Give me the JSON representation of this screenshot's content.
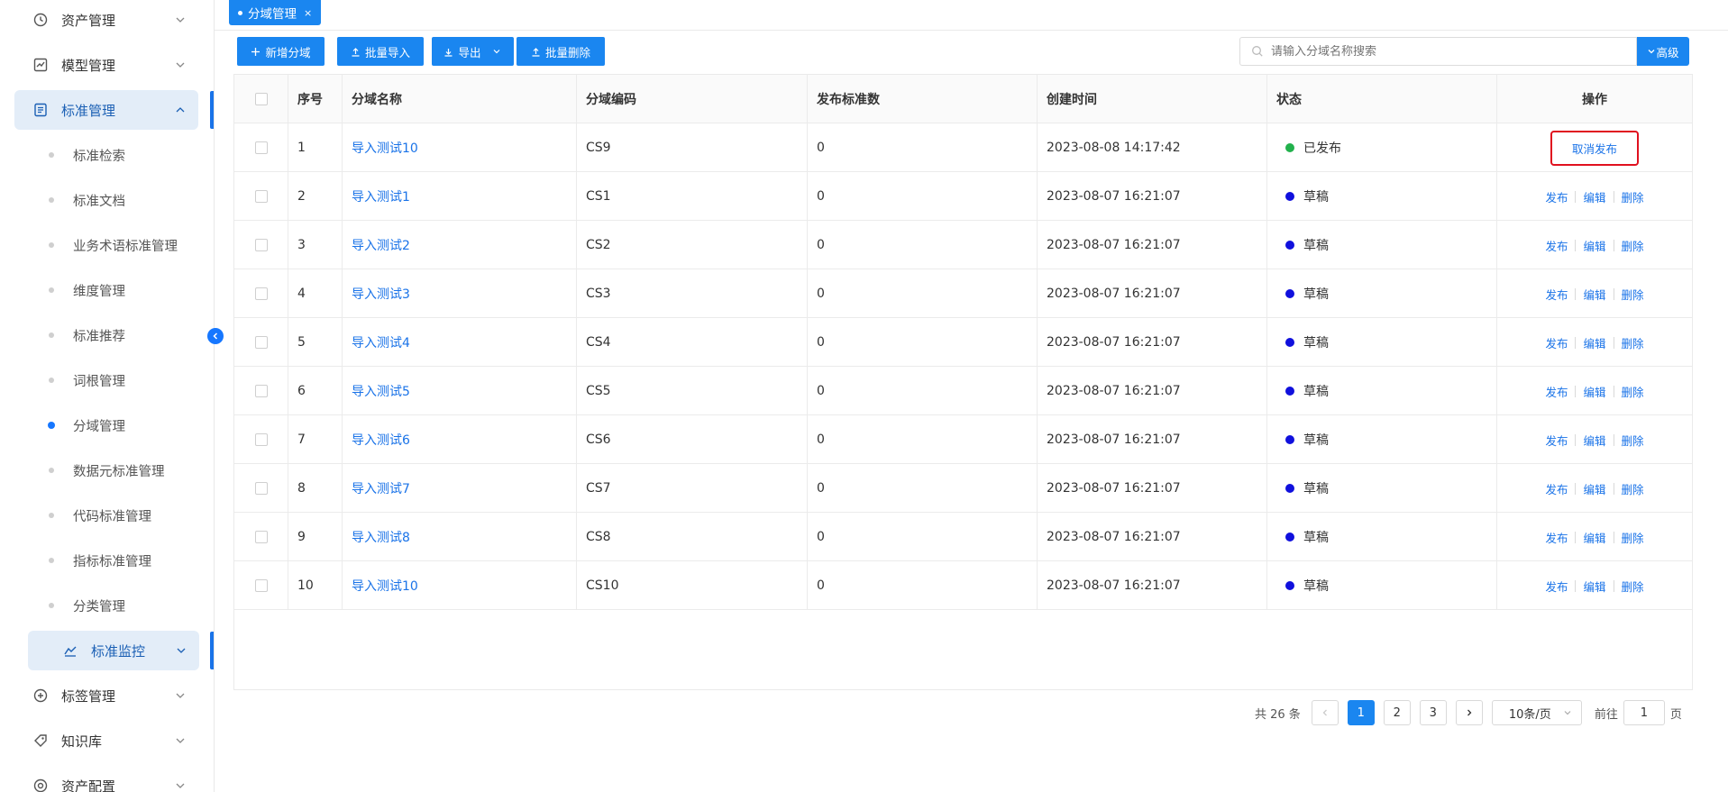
{
  "sidebar": {
    "menus": [
      {
        "label": "资产管理",
        "icon": "clock-icon"
      },
      {
        "label": "模型管理",
        "icon": "chart-icon"
      },
      {
        "label": "标准管理",
        "icon": "document-icon"
      },
      {
        "label": "标签管理",
        "icon": "plus-circle-icon"
      },
      {
        "label": "知识库",
        "icon": "tag-icon"
      },
      {
        "label": "资产配置",
        "icon": "settings-circle-icon"
      }
    ],
    "sub_items": [
      {
        "label": "标准检索"
      },
      {
        "label": "标准文档"
      },
      {
        "label": "业务术语标准管理"
      },
      {
        "label": "维度管理"
      },
      {
        "label": "标准推荐"
      },
      {
        "label": "词根管理"
      },
      {
        "label": "分域管理"
      },
      {
        "label": "数据元标准管理"
      },
      {
        "label": "代码标准管理"
      },
      {
        "label": "指标标准管理"
      },
      {
        "label": "分类管理"
      }
    ],
    "monitor": {
      "label": "标准监控",
      "icon": "monitor-icon"
    }
  },
  "tab": {
    "label": "分域管理",
    "close": "×"
  },
  "toolbar": {
    "add": "新增分域",
    "import": "批量导入",
    "export": "导出",
    "batch_delete": "批量删除",
    "search_placeholder": "请输入分域名称搜索",
    "advanced": "高级"
  },
  "table": {
    "headers": {
      "index": "序号",
      "name": "分域名称",
      "code": "分域编码",
      "count": "发布标准数",
      "created": "创建时间",
      "status": "状态",
      "ops": "操作"
    },
    "rows": [
      {
        "index": "1",
        "name": "导入测试10",
        "code": "CS9",
        "count": "0",
        "created": "2023-08-08 14:17:42",
        "status": "已发布"
      },
      {
        "index": "2",
        "name": "导入测试1",
        "code": "CS1",
        "count": "0",
        "created": "2023-08-07 16:21:07",
        "status": "草稿"
      },
      {
        "index": "3",
        "name": "导入测试2",
        "code": "CS2",
        "count": "0",
        "created": "2023-08-07 16:21:07",
        "status": "草稿"
      },
      {
        "index": "4",
        "name": "导入测试3",
        "code": "CS3",
        "count": "0",
        "created": "2023-08-07 16:21:07",
        "status": "草稿"
      },
      {
        "index": "5",
        "name": "导入测试4",
        "code": "CS4",
        "count": "0",
        "created": "2023-08-07 16:21:07",
        "status": "草稿"
      },
      {
        "index": "6",
        "name": "导入测试5",
        "code": "CS5",
        "count": "0",
        "created": "2023-08-07 16:21:07",
        "status": "草稿"
      },
      {
        "index": "7",
        "name": "导入测试6",
        "code": "CS6",
        "count": "0",
        "created": "2023-08-07 16:21:07",
        "status": "草稿"
      },
      {
        "index": "8",
        "name": "导入测试7",
        "code": "CS7",
        "count": "0",
        "created": "2023-08-07 16:21:07",
        "status": "草稿"
      },
      {
        "index": "9",
        "name": "导入测试8",
        "code": "CS8",
        "count": "0",
        "created": "2023-08-07 16:21:07",
        "status": "草稿"
      },
      {
        "index": "10",
        "name": "导入测试10",
        "code": "CS10",
        "count": "0",
        "created": "2023-08-07 16:21:07",
        "status": "草稿"
      }
    ],
    "ops": {
      "cancel_publish": "取消发布",
      "publish": "发布",
      "edit": "编辑",
      "delete": "删除"
    },
    "status_colors": {
      "published": "#22b14c",
      "draft": "#1010dd"
    }
  },
  "pagination": {
    "total": "共 26 条",
    "pages": [
      "1",
      "2",
      "3"
    ],
    "current": "1",
    "page_size": "10条/页",
    "goto_prefix": "前往",
    "goto_value": "1",
    "goto_suffix": "页"
  },
  "colors": {
    "accent": "#1a86f0",
    "highlight": "#e0111f"
  }
}
